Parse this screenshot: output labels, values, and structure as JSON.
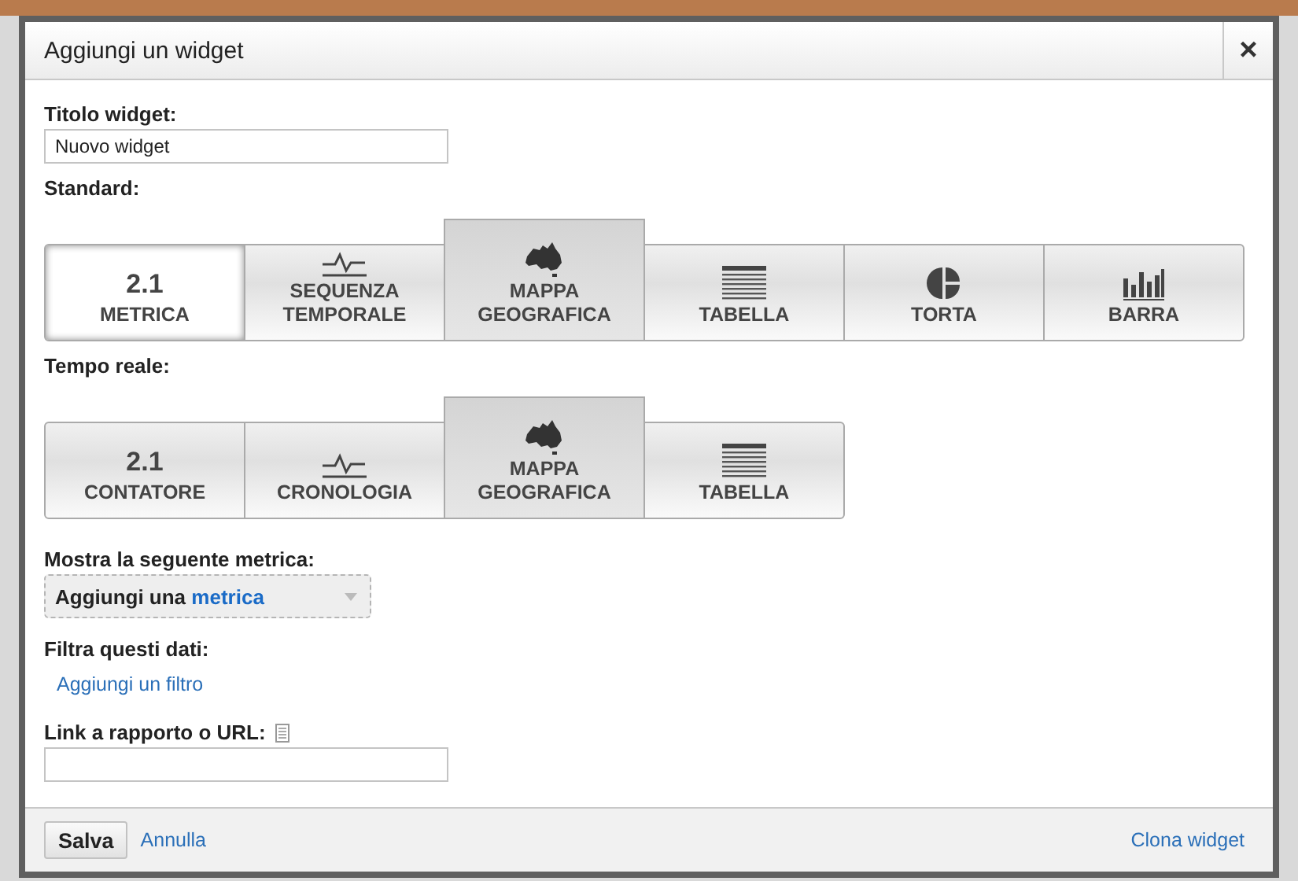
{
  "dialog": {
    "title": "Aggiungi un widget",
    "close": "×"
  },
  "title_field": {
    "label": "Titolo widget:",
    "value": "Nuovo widget"
  },
  "standard": {
    "label": "Standard:",
    "tiles": [
      {
        "kind": "number",
        "figure": "2.1",
        "label": "METRICA",
        "selected": true,
        "highlighted": false
      },
      {
        "kind": "timeline",
        "label": "SEQUENZA TEMPORALE",
        "selected": false,
        "highlighted": false
      },
      {
        "kind": "map",
        "label": "MAPPA GEOGRAFICA",
        "selected": false,
        "highlighted": true
      },
      {
        "kind": "table",
        "label": "TABELLA",
        "selected": false,
        "highlighted": false
      },
      {
        "kind": "pie",
        "label": "TORTA",
        "selected": false,
        "highlighted": false
      },
      {
        "kind": "bar",
        "label": "BARRA",
        "selected": false,
        "highlighted": false
      }
    ]
  },
  "realtime": {
    "label": "Tempo reale:",
    "tiles": [
      {
        "kind": "number",
        "figure": "2.1",
        "label": "CONTATORE",
        "selected": false,
        "highlighted": false
      },
      {
        "kind": "timeline",
        "label": "CRONOLOGIA",
        "selected": false,
        "highlighted": false
      },
      {
        "kind": "map",
        "label": "MAPPA GEOGRAFICA",
        "selected": false,
        "highlighted": true
      },
      {
        "kind": "table",
        "label": "TABELLA",
        "selected": false,
        "highlighted": false
      }
    ]
  },
  "metric": {
    "label": "Mostra la seguente metrica:",
    "picker_prefix": "Aggiungi una",
    "picker_link": "metrica"
  },
  "filter": {
    "label": "Filtra questi dati:",
    "link": "Aggiungi un filtro"
  },
  "link_field": {
    "label": "Link a rapporto o URL:"
  },
  "footer": {
    "save": "Salva",
    "cancel": "Annulla",
    "clone": "Clona widget"
  }
}
